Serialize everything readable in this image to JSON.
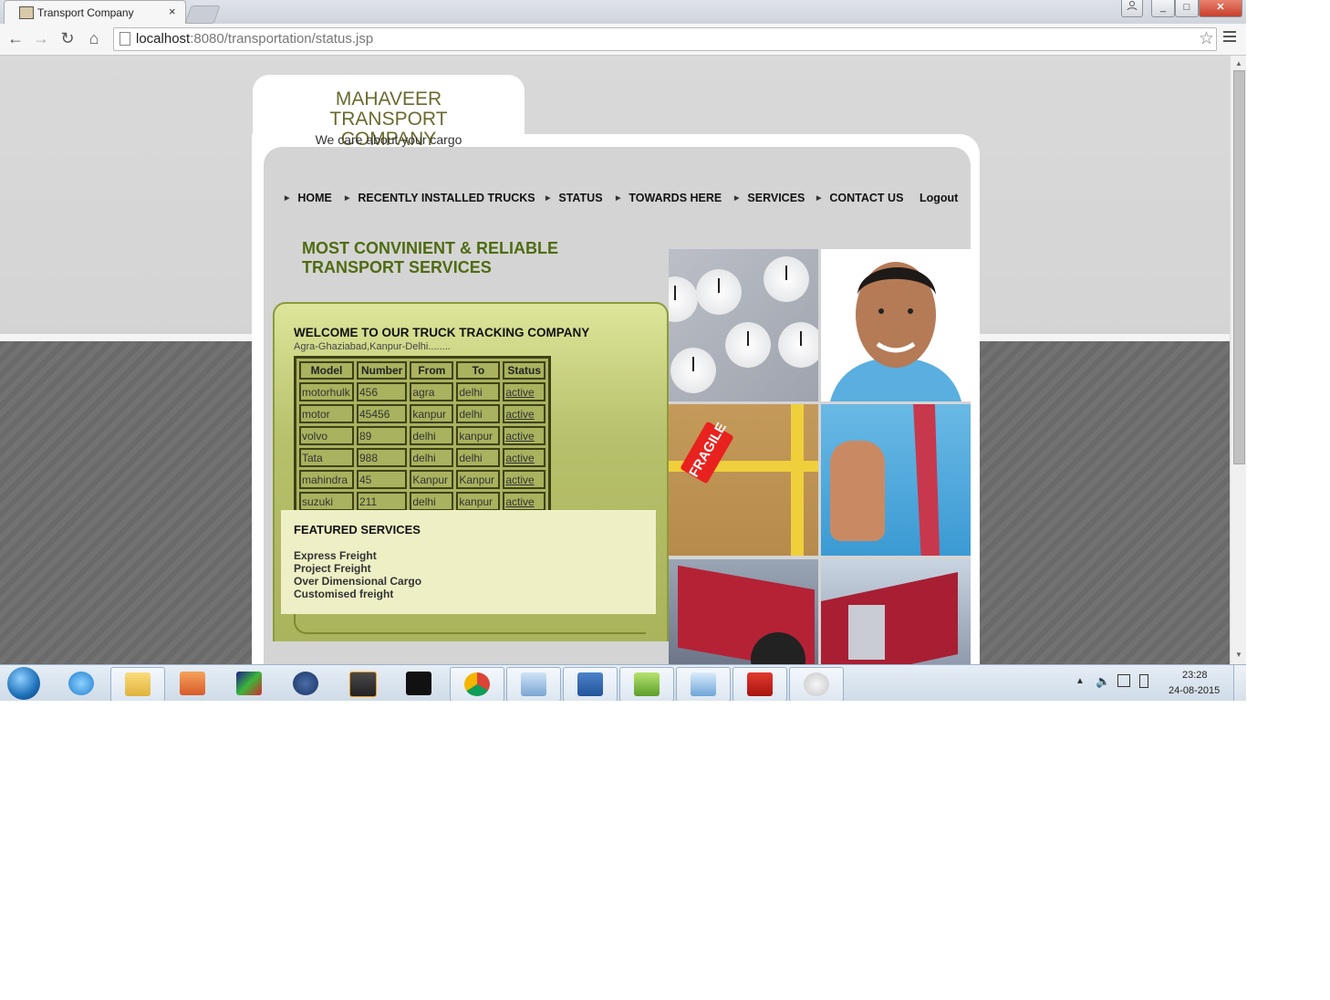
{
  "browser": {
    "tab_title": "Transport Company",
    "tab_close": "×",
    "url_host": "localhost",
    "url_path": ":8080/transportation/status.jsp",
    "window_buttons": [
      "_",
      "□",
      "✕"
    ]
  },
  "site": {
    "company_name": "MAHAVEER TRANSPORT COMPANY",
    "tagline": "We care about your cargo",
    "nav": [
      "HOME",
      "RECENTLY INSTALLED TRUCKS",
      "STATUS",
      "TOWARDS HERE",
      "SERVICES",
      "CONTACT US"
    ],
    "logout": "Logout",
    "headline_line1": "MOST CONVINIENT & RELIABLE",
    "headline_line2": "TRANSPORT SERVICES",
    "welcome": "WELCOME TO OUR TRUCK TRACKING COMPANY",
    "route": "Agra-Ghaziabad,Kanpur-Delhi........",
    "table": {
      "headers": [
        "Model",
        "Number",
        "From",
        "To",
        "Status"
      ],
      "rows": [
        [
          "motorhulk",
          "456",
          "agra",
          "delhi",
          "active"
        ],
        [
          "motor",
          "45456",
          "kanpur",
          "delhi",
          "active"
        ],
        [
          "volvo",
          "89",
          "delhi",
          "kanpur",
          "active"
        ],
        [
          "Tata",
          "988",
          "delhi",
          "delhi",
          "active"
        ],
        [
          "mahindra",
          "45",
          "Kanpur",
          "Kanpur",
          "active"
        ],
        [
          "suzuki",
          "211",
          "delhi",
          "kanpur",
          "active"
        ]
      ]
    },
    "featured_title": "FEATURED SERVICES",
    "featured_items": [
      "Express Freight",
      "Project Freight",
      "Over Dimensional Cargo",
      "Customised freight"
    ],
    "fragile_label": "FRAGILE"
  },
  "taskbar": {
    "time": "23:28",
    "date": "24-08-2015",
    "apps": [
      "internet-explorer",
      "file-explorer",
      "app-folder",
      "app-monitor",
      "hp",
      "sublime",
      "cmd",
      "chrome",
      "virtualbox",
      "word",
      "notepad-plus",
      "remote-desktop",
      "acrobat",
      "paint"
    ]
  },
  "colors": {
    "headline": "#4f6b10",
    "company": "#6b6a2e",
    "panel": "#c6cf7c"
  }
}
